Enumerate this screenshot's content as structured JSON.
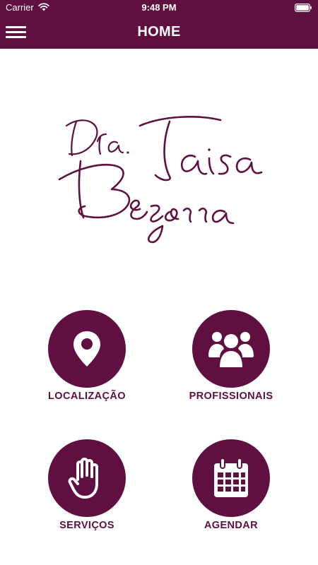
{
  "status_bar": {
    "carrier": "Carrier",
    "time": "9:48 PM",
    "wifi_icon": "wifi-icon",
    "battery_icon": "battery-icon"
  },
  "nav": {
    "title": "HOME",
    "menu_icon": "hamburger-menu-icon"
  },
  "logo": {
    "text": "Dra. Taisa Bezerra"
  },
  "actions": [
    {
      "label": "LOCALIZAÇÃO",
      "icon": "location-pin-icon"
    },
    {
      "label": "PROFISSIONAIS",
      "icon": "people-group-icon"
    },
    {
      "label": "SERVIÇOS",
      "icon": "hand-icon"
    },
    {
      "label": "AGENDAR",
      "icon": "calendar-icon"
    }
  ],
  "colors": {
    "brand": "#5f0f40",
    "background": "#ffffff",
    "text_on_brand": "#ffffff"
  }
}
